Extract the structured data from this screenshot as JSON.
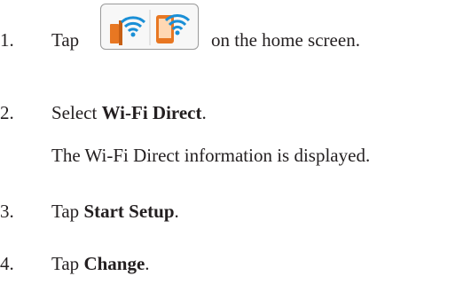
{
  "steps": [
    {
      "number": "1.",
      "before": "Tap",
      "icon": "wifi-direct-status-icon",
      "after": "on the home screen."
    },
    {
      "number": "2.",
      "before": "Select ",
      "bold": "Wi-Fi Direct",
      "after": ".",
      "note": "The Wi-Fi Direct information is displayed."
    },
    {
      "number": "3.",
      "before": "Tap ",
      "bold": "Start Setup",
      "after": "."
    },
    {
      "number": "4.",
      "before": "Tap ",
      "bold": "Change",
      "after": "."
    }
  ],
  "colors": {
    "text": "#231f20",
    "icon_orange": "#e87722",
    "icon_blue": "#1a8fd6"
  }
}
